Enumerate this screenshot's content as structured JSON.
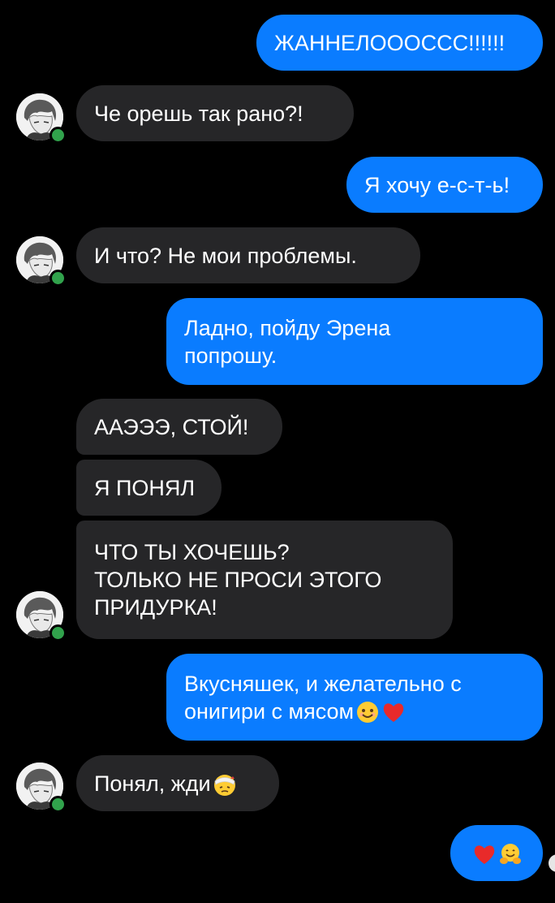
{
  "colors": {
    "background": "#000000",
    "outgoing_bubble": "#0a7cff",
    "incoming_bubble": "#262628",
    "online": "#31a24c"
  },
  "messages": [
    {
      "side": "out",
      "text": "ЖАННЕЛОООССС!!!!!!"
    },
    {
      "side": "in",
      "text": "Че орешь так рано?!"
    },
    {
      "side": "out",
      "text": "Я хочу е-с-т-ь!"
    },
    {
      "side": "in",
      "text": "И что? Не мои проблемы."
    },
    {
      "side": "out",
      "text": "Ладно, пойду Эрена\nпопрошу."
    },
    {
      "side": "in",
      "text": "ААЭЭЭ, СТОЙ!"
    },
    {
      "side": "in",
      "text": "Я ПОНЯЛ"
    },
    {
      "side": "in",
      "text": "ЧТО ТЫ ХОЧЕШЬ?\nТОЛЬКО НЕ ПРОСИ ЭТОГО\nПРИДУРКА!"
    },
    {
      "side": "out",
      "text": "Вкусняшек, и желательно с\nонигири с мясом",
      "emojis": [
        "smiling-face-emoji",
        "red-heart-emoji"
      ]
    },
    {
      "side": "in",
      "text": "Понял, жди",
      "emojis": [
        "face-with-head-bandage-emoji"
      ]
    },
    {
      "side": "out",
      "text": "",
      "emojis": [
        "red-heart-emoji",
        "hugging-face-emoji"
      ]
    }
  ]
}
